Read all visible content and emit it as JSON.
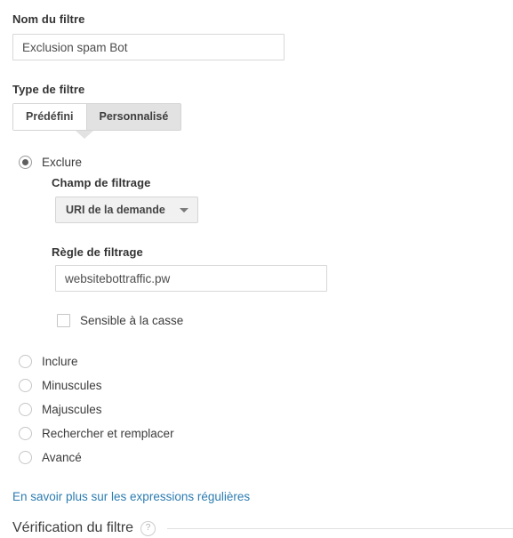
{
  "filter_name": {
    "label": "Nom du filtre",
    "value": "Exclusion spam Bot",
    "placeholder": ""
  },
  "filter_type": {
    "label": "Type de filtre",
    "tabs": [
      {
        "label": "Prédéfini",
        "active": false
      },
      {
        "label": "Personnalisé",
        "active": true
      }
    ]
  },
  "custom_filter": {
    "options": [
      {
        "label": "Exclure",
        "selected": true
      },
      {
        "label": "Inclure",
        "selected": false
      },
      {
        "label": "Minuscules",
        "selected": false
      },
      {
        "label": "Majuscules",
        "selected": false
      },
      {
        "label": "Rechercher et remplacer",
        "selected": false
      },
      {
        "label": "Avancé",
        "selected": false
      }
    ],
    "filter_field": {
      "label": "Champ de filtrage",
      "selected_value": "URI de la demande",
      "arrow_icon": "chevron-down-icon"
    },
    "filter_pattern": {
      "label": "Règle de filtrage",
      "value": "websitebottraffic.pw",
      "placeholder": ""
    },
    "case_sensitive": {
      "label": "Sensible à la casse",
      "checked": false
    }
  },
  "learn_more_link": "En savoir plus sur les expressions régulières",
  "verification": {
    "title": "Vérification du filtre",
    "help_icon": "help-question-icon",
    "help_glyph": "?"
  },
  "colors": {
    "link": "#2c7cb0",
    "active_tab_bg": "#e2e2e2",
    "input_border": "#d8d8d8",
    "text": "#333333"
  }
}
